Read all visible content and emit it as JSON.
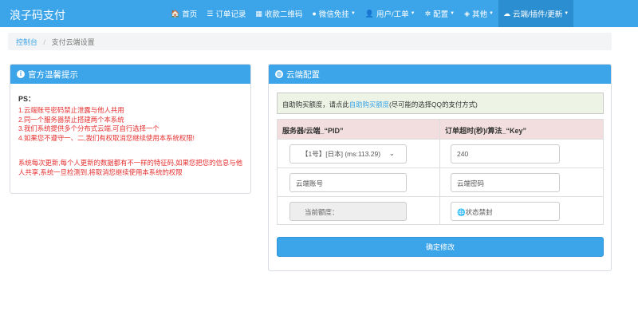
{
  "brand": "浪子码支付",
  "nav": [
    {
      "icon": "home-icon",
      "glyph": "🏠",
      "label": "首页",
      "caret": false
    },
    {
      "icon": "list-icon",
      "glyph": "☰",
      "label": "订单记录",
      "caret": false
    },
    {
      "icon": "qrcode-icon",
      "glyph": "▦",
      "label": "收款二维码",
      "caret": false
    },
    {
      "icon": "wechat-icon",
      "glyph": "●",
      "label": "微信免挂",
      "caret": true
    },
    {
      "icon": "user-icon",
      "glyph": "👤",
      "label": "用户/工单",
      "caret": true
    },
    {
      "icon": "gear-icon",
      "glyph": "✲",
      "label": "配置",
      "caret": true
    },
    {
      "icon": "cube-icon",
      "glyph": "◈",
      "label": "其他",
      "caret": true
    },
    {
      "icon": "cloud-icon",
      "glyph": "☁",
      "label": "云端/插件/更新",
      "caret": true
    }
  ],
  "breadcrumb": {
    "home": "控制台",
    "current": "支付云端设置"
  },
  "left_panel": {
    "title": "官方温馨提示",
    "ps": "PS：",
    "rules": [
      "1.云端账号密码禁止泄露与他人共用",
      "2.同一个服务器禁止搭建两个本系统",
      "3.我们系统提供多个分布式云端,可自行选择一个",
      "4.如果您不遵守一、二,我们有权取消您继续使用本系统权限!"
    ],
    "note": "系统每次更新,每个人更新的数据都有不一样的特征码,如果您把您的信息与他人共享,系统一旦检测到,将取消您继续使用本系统的权限"
  },
  "right_panel": {
    "title": "云端配置",
    "alert_prefix": "自助购买额度，请点此",
    "alert_link": "自助购买额度",
    "alert_suffix": "(尽可能的选择QQ的支付方式)",
    "col1": "服务器/云端_“PID”",
    "col2": "订单超时(秒)/算法_“Key”",
    "server_select": "【1号】[日本] (ms:113.29)",
    "timeout_value": "240",
    "account_placeholder": "云端账号",
    "password_placeholder": "云端密码",
    "quota_label": "当前额度：",
    "status_value": "🌐状态禁封",
    "submit": "确定修改"
  }
}
